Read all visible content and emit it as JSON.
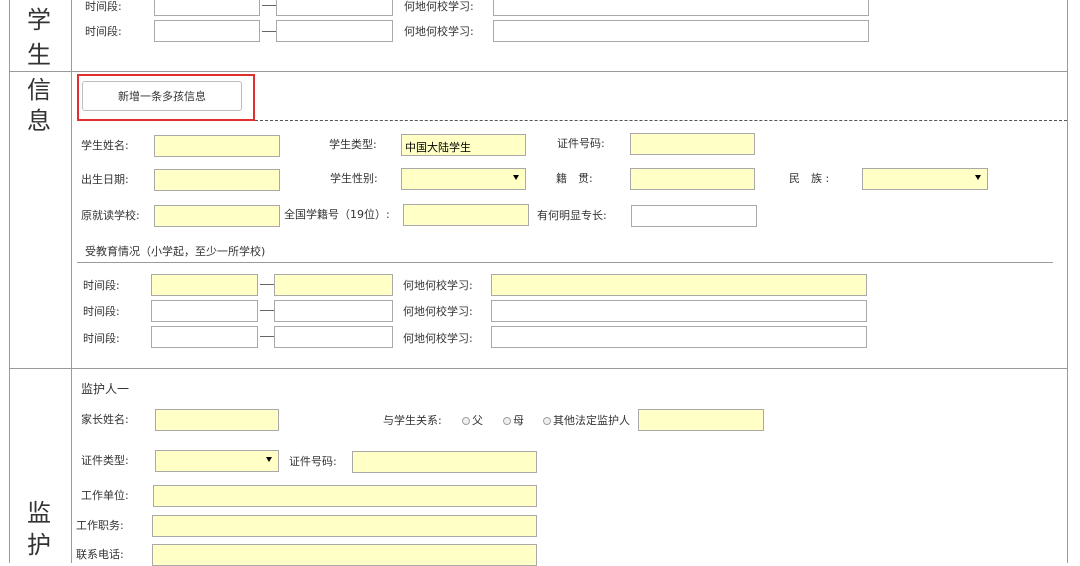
{
  "sections": {
    "student_side": [
      "学",
      "生",
      "信",
      "息"
    ],
    "guardian_side": [
      "监",
      "护"
    ]
  },
  "top_rows": [
    {
      "period_label": "时间段:",
      "where_label": "何地何校学习:"
    },
    {
      "period_label": "时间段:",
      "where_label": "何地何校学习:"
    }
  ],
  "add_button": {
    "label": "新增一条多孩信息"
  },
  "student": {
    "name_label": "学生姓名:",
    "type_label": "学生类型:",
    "type_value": "中国大陆学生",
    "id_label": "证件号码:",
    "birth_label": "出生日期:",
    "gender_label": "学生性别:",
    "native_label": "籍　贯:",
    "ethnic_label": "民　族 :",
    "school_label": "原就读学校:",
    "national_id_label": "全国学籍号（19位）:",
    "talent_label": "有何明显专长:"
  },
  "education": {
    "title": "受教育情况（小学起，至少一所学校)",
    "rows": [
      {
        "period_label": "时间段:",
        "where_label": "何地何校学习:",
        "required": true
      },
      {
        "period_label": "时间段:",
        "where_label": "何地何校学习:",
        "required": false
      },
      {
        "period_label": "时间段:",
        "where_label": "何地何校学习:",
        "required": false
      }
    ]
  },
  "guardian": {
    "title": "监护人一",
    "name_label": "家长姓名:",
    "relation_label": "与学生关系:",
    "relation_options": [
      "父",
      "母",
      "其他法定监护人"
    ],
    "doc_type_label": "证件类型:",
    "doc_no_label": "证件号码:",
    "employer_label": "工作单位:",
    "position_label": "工作职务:",
    "phone_label": "联系电话:"
  },
  "colors": {
    "required_field_bg": "#ffffc6",
    "highlight_frame": "#e03030",
    "border": "#9a9a9a"
  }
}
